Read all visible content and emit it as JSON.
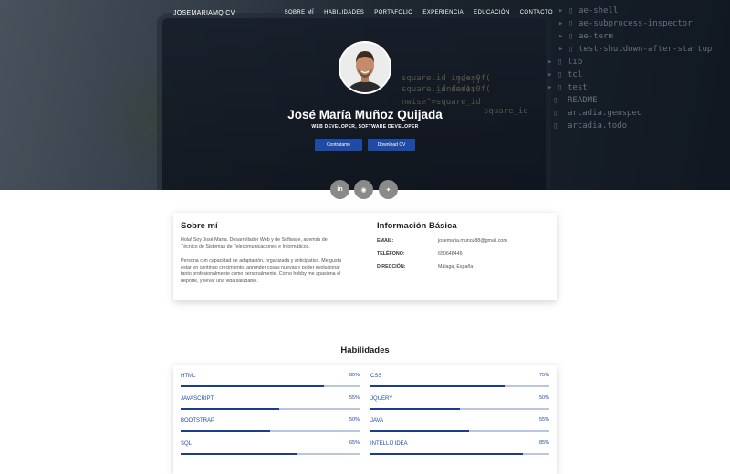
{
  "nav": {
    "brand": "JOSEMARIAMQ CV",
    "items": [
      "SOBRE MÍ",
      "HABILIDADES",
      "PORTAFOLIO",
      "EXPERIENCIA",
      "EDUCACIÓN",
      "CONTACTO"
    ]
  },
  "hero": {
    "name": "José María Muñoz Quijada",
    "role": "WEB DEVELOPER, SOFTWARE DEVELOPER",
    "contact_button": "Contrátame",
    "download_button": "Download CV",
    "code_lines": [
      "ae-shell",
      "ae-subprocess-inspector",
      "ae-term",
      "test-shutdown-after-startup",
      "lib",
      "tcl",
      "test",
      "README",
      "arcadia.gemspec",
      "arcadia.todo",
      "]=\");",
      "_index);",
      "square_id",
      "nwise\"=square_id",
      "square.id index0f(",
      "square.id index0f("
    ],
    "social": [
      {
        "icon": "linkedin-icon",
        "glyph": "in"
      },
      {
        "icon": "github-icon",
        "glyph": "◉"
      },
      {
        "icon": "twitter-icon",
        "glyph": "✦"
      }
    ]
  },
  "about": {
    "title": "Sobre mí",
    "p1": "Hola! Soy José María. Desarrollador Web y de Software, además de Técnico de Sistemas de Telecomunicaciones e Informáticos.",
    "p2": "Persona con capacidad de adaptación, organizada y anticipativa. Me gusta estar en continuo crecimiento, aprender cosas nuevas y poder evolucionar tanto profesionalmente como personalmente. Como hobby me apasiona el deporte, y llevar una vida saludable."
  },
  "info": {
    "title": "Información Básica",
    "email_label": "EMAIL:",
    "email": "josemaria.munoz88@gmail.com",
    "phone_label": "TELÉFONO:",
    "phone": "650648446",
    "address_label": "DIRECCIÓN:",
    "address": "Málaga, España"
  },
  "skills": {
    "title": "Habilidades",
    "items": [
      {
        "name": "HTML",
        "pct": "80%",
        "value": 80
      },
      {
        "name": "CSS",
        "pct": "75%",
        "value": 75
      },
      {
        "name": "JAVASCRIPT",
        "pct": "55%",
        "value": 55
      },
      {
        "name": "JQUERY",
        "pct": "50%",
        "value": 50
      },
      {
        "name": "BOOTSTRAP",
        "pct": "50%",
        "value": 50
      },
      {
        "name": "JAVA",
        "pct": "55%",
        "value": 55
      },
      {
        "name": "SQL",
        "pct": "65%",
        "value": 65
      },
      {
        "name": "INTELLIJ IDEA",
        "pct": "85%",
        "value": 85
      }
    ]
  },
  "colors": {
    "accent": "#1f4aa6",
    "bar": "#1a3d8f",
    "track": "#b9c6dd",
    "social": "#8a8a8a"
  }
}
